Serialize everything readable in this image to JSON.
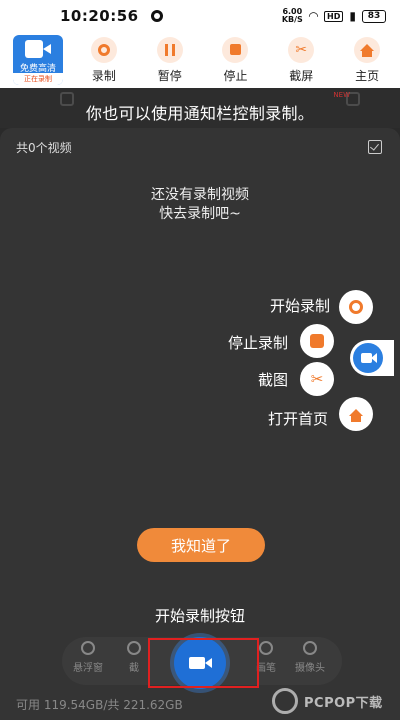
{
  "status_bar": {
    "time": "10:20:56",
    "speed_value": "6.00",
    "speed_unit": "KB/S",
    "hd_badge": "HD",
    "battery": "83"
  },
  "toolbar": {
    "app_title": "免费高清",
    "app_status": "正在录制",
    "buttons": [
      {
        "label": "录制",
        "icon": "record-icon"
      },
      {
        "label": "暂停",
        "icon": "pause-icon"
      },
      {
        "label": "停止",
        "icon": "stop-icon"
      },
      {
        "label": "截屏",
        "icon": "scissors-icon"
      },
      {
        "label": "主页",
        "icon": "home-icon"
      }
    ]
  },
  "banner": {
    "hint": "你也可以使用通知栏控制录制。",
    "new_tag": "NEW"
  },
  "panel": {
    "video_count": "共0个视频",
    "empty_line1": "还没有录制视频",
    "empty_line2": "快去录制吧~"
  },
  "guide": {
    "items": [
      {
        "label": "开始录制",
        "icon": "record-icon"
      },
      {
        "label": "停止录制",
        "icon": "stop-icon"
      },
      {
        "label": "截图",
        "icon": "scissors-icon"
      },
      {
        "label": "打开首页",
        "icon": "home-icon"
      }
    ],
    "got_it": "我知道了",
    "start_tip": "开始录制按钮"
  },
  "bottom_nav": {
    "items": [
      {
        "label": "悬浮窗"
      },
      {
        "label": "截"
      },
      {
        "label": "画笔"
      },
      {
        "label": "摄像头"
      }
    ]
  },
  "storage": "可用 119.54GB/共 221.62GB",
  "watermark": "PCPOP下载",
  "colors": {
    "accent_orange": "#f07a2c",
    "brand_blue": "#2b7fe0",
    "highlight_red": "#e02020"
  }
}
